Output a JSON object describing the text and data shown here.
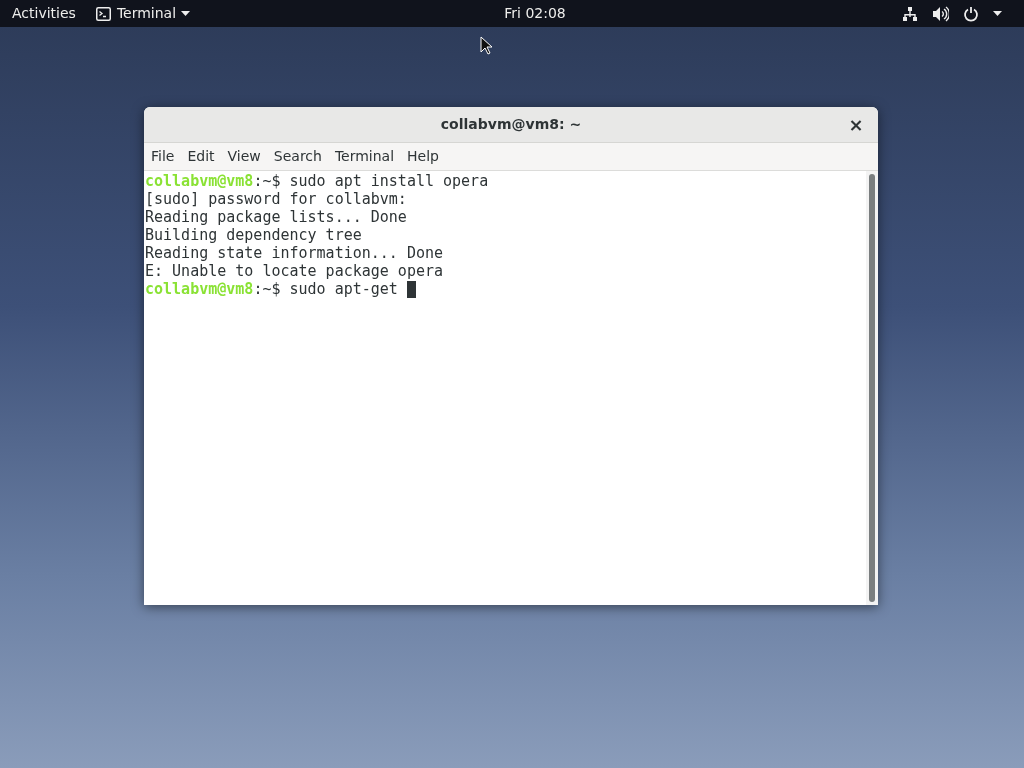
{
  "top_bar": {
    "activities": "Activities",
    "app_menu": "Terminal",
    "clock": "Fri 02:08"
  },
  "window": {
    "title": "collabvm@vm8: ~",
    "close": "×"
  },
  "menu": [
    "File",
    "Edit",
    "View",
    "Search",
    "Terminal",
    "Help"
  ],
  "terminal_lines": [
    {
      "kind": "prompt",
      "user": "collabvm@vm8",
      "rest": ":~$ sudo apt install opera",
      "cursor": false
    },
    {
      "kind": "output",
      "text": "[sudo] password for collabvm:"
    },
    {
      "kind": "output",
      "text": "Reading package lists... Done"
    },
    {
      "kind": "output",
      "text": "Building dependency tree"
    },
    {
      "kind": "output",
      "text": "Reading state information... Done"
    },
    {
      "kind": "output",
      "text": "E: Unable to locate package opera"
    },
    {
      "kind": "prompt",
      "user": "collabvm@vm8",
      "rest": ":~$ sudo apt-get ",
      "cursor": true
    }
  ]
}
